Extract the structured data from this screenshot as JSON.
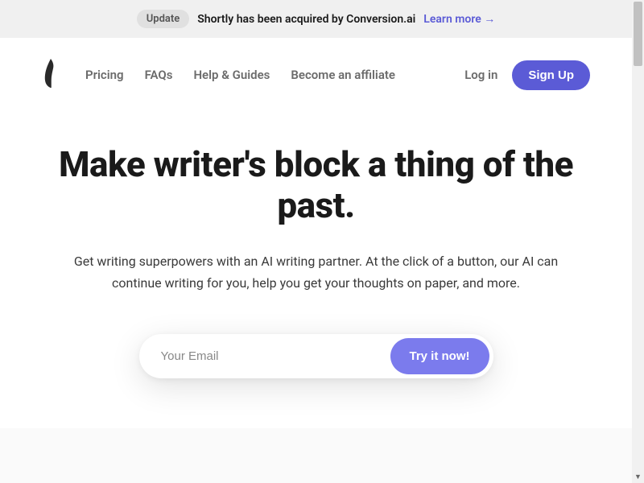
{
  "banner": {
    "badge": "Update",
    "text": "Shortly has been acquired by Conversion.ai",
    "link_text": "Learn more →"
  },
  "nav": {
    "links": [
      "Pricing",
      "FAQs",
      "Help & Guides",
      "Become an affiliate"
    ],
    "login": "Log in",
    "signup": "Sign Up"
  },
  "hero": {
    "title": "Make writer's block a thing of the past.",
    "subtitle": "Get writing superpowers with an AI writing partner. At the click of a button, our AI can continue writing for you, help you get your thoughts on paper, and more.",
    "email_placeholder": "Your Email",
    "submit_label": "Try it now!"
  }
}
